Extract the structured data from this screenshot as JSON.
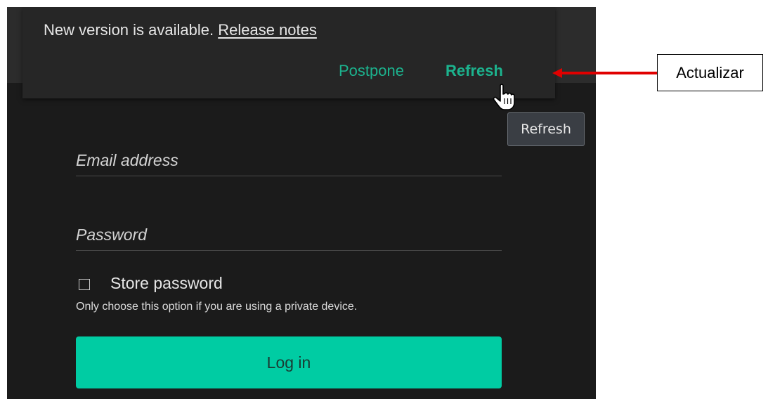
{
  "update_banner": {
    "message": "New version is available.",
    "release_notes_link": "Release notes",
    "postpone_label": "Postpone",
    "refresh_label": "Refresh"
  },
  "tooltip": {
    "text": "Refresh"
  },
  "login_form": {
    "email_placeholder": "Email address",
    "email_value": "",
    "password_placeholder": "Password",
    "password_value": "",
    "store_password_label": "Store password",
    "store_password_checked": false,
    "store_password_hint": "Only choose this option if you are using a private device.",
    "login_button_label": "Log in"
  },
  "annotation": {
    "callout_text": "Actualizar",
    "arrow_color": "#e00000"
  },
  "colors": {
    "accent": "#00cca3",
    "link_green": "#1cb38e",
    "background": "#1b1b1b"
  },
  "icons": {
    "cursor": "hand-pointer-icon",
    "arrow": "left-arrow-icon",
    "checkbox": "checkbox-unchecked-icon"
  }
}
